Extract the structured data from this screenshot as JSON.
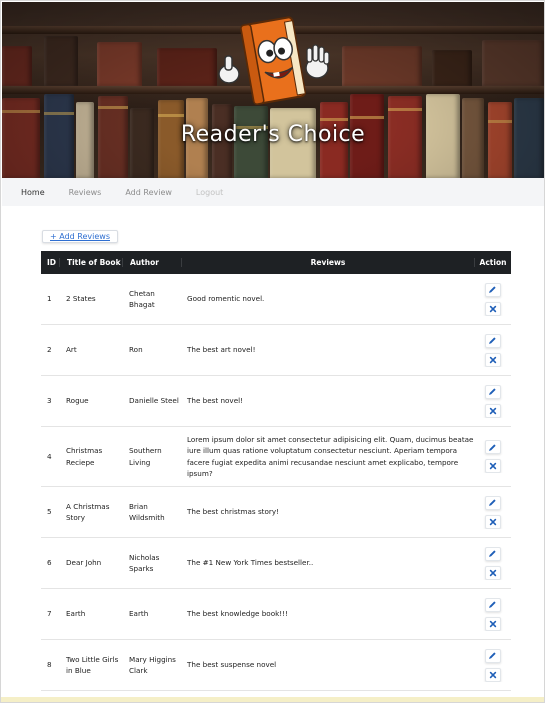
{
  "header": {
    "site_title": "Reader's Choice",
    "mascot": "smiling-book-mascot"
  },
  "nav": {
    "items": [
      {
        "label": "Home",
        "state": "active"
      },
      {
        "label": "Reviews",
        "state": "normal"
      },
      {
        "label": "Add Review",
        "state": "normal"
      },
      {
        "label": "Logout",
        "state": "disabled"
      }
    ]
  },
  "toolbar": {
    "add_reviews_label": "+ Add Reviews"
  },
  "table": {
    "columns": [
      "ID",
      "Title of Book",
      "Author",
      "Reviews",
      "Action"
    ],
    "rows": [
      {
        "id": "1",
        "title": "2 States",
        "author": "Chetan Bhagat",
        "review": "Good romentic novel."
      },
      {
        "id": "2",
        "title": "Art",
        "author": "Ron",
        "review": "The best art novel!"
      },
      {
        "id": "3",
        "title": "Rogue",
        "author": "Danielle Steel",
        "review": "The best novel!"
      },
      {
        "id": "4",
        "title": "Christmas Reciepe",
        "author": "Southern Living",
        "review": "Lorem ipsum dolor sit amet consectetur adipisicing elit. Quam, ducimus beatae iure illum quas ratione voluptatum consectetur nesciunt. Aperiam tempora facere fugiat expedita animi recusandae nesciunt amet explicabo, tempore ipsum?"
      },
      {
        "id": "5",
        "title": "A Christmas Story",
        "author": "Brian Wildsmith",
        "review": "The best christmas story!"
      },
      {
        "id": "6",
        "title": "Dear John",
        "author": "Nicholas Sparks",
        "review": "The #1 New York Times bestseller.."
      },
      {
        "id": "7",
        "title": "Earth",
        "author": "Earth",
        "review": "The best knowledge book!!!"
      },
      {
        "id": "8",
        "title": "Two Little Girls in Blue",
        "author": "Mary Higgins Clark",
        "review": "The best suspense novel"
      }
    ],
    "row_actions": {
      "edit_icon": "pencil-icon",
      "delete_icon": "close-icon"
    }
  },
  "colors": {
    "table_header_bg": "#1e2124",
    "link_blue": "#2f6fd1",
    "icon_blue": "#1f5fb8",
    "nav_bg": "#f4f5f7"
  }
}
